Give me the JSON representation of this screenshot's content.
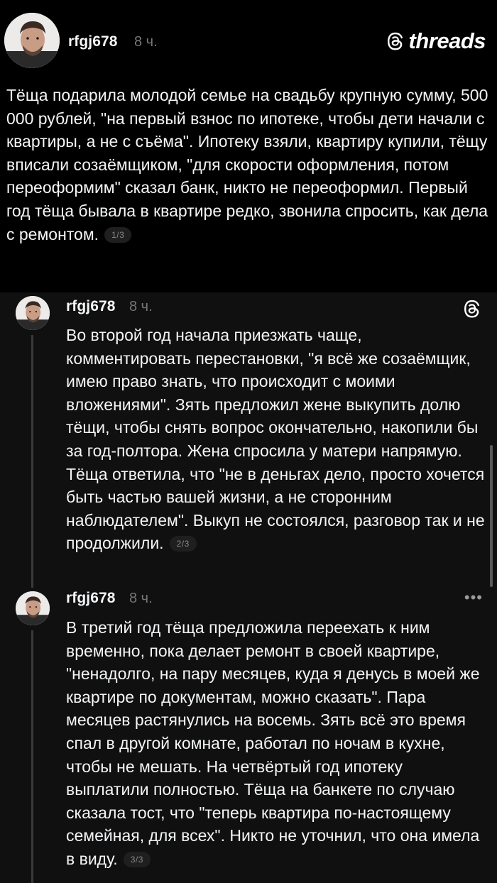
{
  "brand": {
    "name": "threads",
    "mark_icon": "threads-at-icon",
    "colors": {
      "background": "#000000",
      "reply_background": "#101010",
      "text": "#f3f5f7",
      "muted": "#777777"
    }
  },
  "posts": [
    {
      "username": "rfgj678",
      "time": "8 ч.",
      "text": "Тёща подарила молодой семье на свадьбу крупную сумму, 500 000 рублей, \"на первый взнос по ипотеке, чтобы дети начали с квартиры, а не с съёма\". Ипотеку взяли, квартиру купили, тёщу вписали созаёмщиком, \"для скорости оформления, потом переоформим\" сказал банк, никто не переоформил. Первый год тёща бывала в квартире редко, звонила спросить, как дела с ремонтом.",
      "counter": "1/3"
    },
    {
      "username": "rfgj678",
      "time": "8 ч.",
      "text": "Во второй год начала приезжать чаще, комментировать перестановки, \"я всё же созаёмщик, имею право знать, что происходит с моими вложениями\". Зять предложил жене выкупить долю тёщи, чтобы снять вопрос окончательно, накопили бы за год-полтора. Жена спросила у матери напрямую. Тёща ответила, что \"не в деньгах дело, просто хочется быть частью вашей жизни, а не сторонним наблюдателем\". Выкуп не состоялся, разговор так и не продолжили.",
      "counter": "2/3"
    },
    {
      "username": "rfgj678",
      "time": "8 ч.",
      "text": "В третий год тёща предложила переехать к ним временно, пока делает ремонт в своей квартире, \"ненадолго, на пару месяцев, куда я денусь в моей же квартире по документам, можно сказать\". Пара месяцев растянулись на восемь. Зять всё это время спал в другой комнате, работал по ночам в кухне, чтобы не мешать. На четвёртый год ипотеку выплатили полностью. Тёща на банкете по случаю сказала тост, что \"теперь квартира по-настоящему семейная, для всех\". Никто не уточнил, что она имела в виду.",
      "counter": "3/3",
      "more_label": "•••"
    }
  ]
}
